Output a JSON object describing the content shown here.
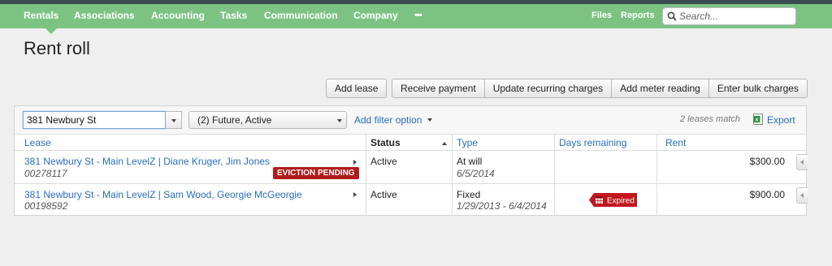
{
  "nav": {
    "items": [
      "Rentals",
      "Associations",
      "Accounting",
      "Tasks",
      "Communication",
      "Company",
      "•••"
    ],
    "files": "Files",
    "reports": "Reports",
    "search_placeholder": "Search..."
  },
  "page": {
    "title": "Rent roll"
  },
  "actions": [
    "Add lease",
    "Receive payment",
    "Update recurring charges",
    "Add meter reading",
    "Enter bulk charges"
  ],
  "filters": {
    "lease_value": "381 Newbury St",
    "status_value": "(2) Future, Active",
    "add_filter": "Add filter option",
    "match_count": "2 leases match",
    "export": "Export"
  },
  "table": {
    "columns": [
      "Lease",
      "Status",
      "Type",
      "Days remaining",
      "Rent"
    ],
    "rows": [
      {
        "lease": "381 Newbury St - Main LevelZ | Diane Kruger, Jim Jones",
        "lease_id": "00278117",
        "badge": "EVICTION PENDING",
        "status": "Active",
        "type": "At will",
        "type_dates": "6/5/2014",
        "days_remaining": "",
        "rent": "$300.00"
      },
      {
        "lease": "381 Newbury St - Main LevelZ | Sam Wood, Georgie McGeorgie",
        "lease_id": "00198592",
        "badge": "",
        "status": "Active",
        "type": "Fixed",
        "type_dates": "1/29/2013 - 6/4/2014",
        "days_remaining": "Expired",
        "rent": "$900.00"
      }
    ]
  },
  "colors": {
    "nav_bg": "#7cc383",
    "link": "#2a6ebd",
    "eviction": "#b31b1b",
    "expired": "#c3161c"
  }
}
